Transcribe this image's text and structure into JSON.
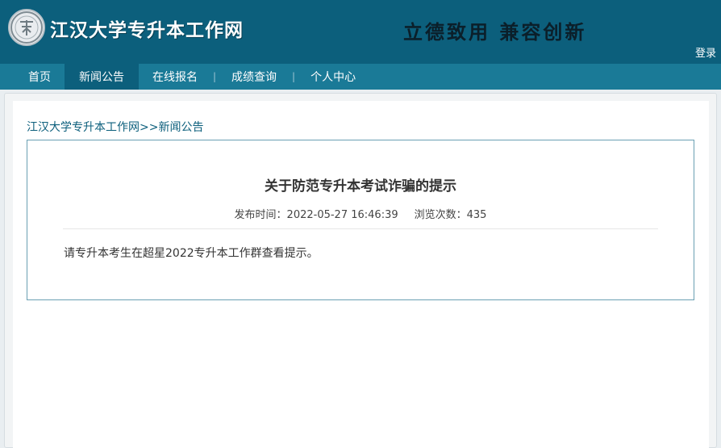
{
  "header": {
    "site_title": "江汉大学专升本工作网",
    "motto": "立德致用  兼容创新",
    "login": "登录",
    "logo": "江汉大学校徽"
  },
  "nav": {
    "items": [
      {
        "label": "首页"
      },
      {
        "label": "新闻公告"
      },
      {
        "label": "在线报名"
      },
      {
        "label": "成绩查询"
      },
      {
        "label": "个人中心"
      }
    ],
    "separator": "|",
    "active_index": 1
  },
  "breadcrumb": {
    "home": "江汉大学专升本工作网",
    "sep": ">>",
    "current": "新闻公告"
  },
  "article": {
    "title": "关于防范专升本考试诈骗的提示",
    "publish_label": "发布时间：",
    "publish_time": "2022-05-27 16:46:39",
    "views_label": "浏览次数：",
    "views": "435",
    "body": "请专升本考生在超星2022专升本工作群查看提示。"
  },
  "colors": {
    "header_bg": "#0c5f7c",
    "nav_bg": "#1a7a97",
    "link": "#0c5f7c",
    "article_border": "#6aa0b3"
  }
}
